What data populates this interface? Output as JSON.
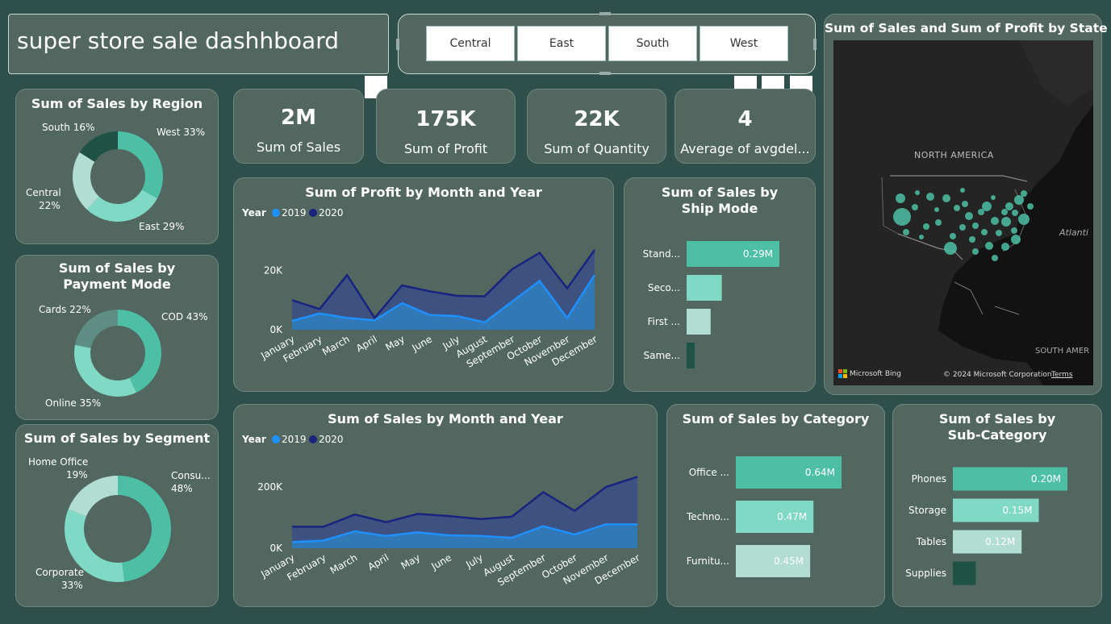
{
  "title": "super store sale dashhboard",
  "slicer": {
    "options": [
      "Central",
      "East",
      "South",
      "West"
    ]
  },
  "kpis": [
    {
      "value": "2M",
      "label": "Sum of Sales"
    },
    {
      "value": "175K",
      "label": "Sum of Profit"
    },
    {
      "value": "22K",
      "label": "Sum of Quantity"
    },
    {
      "value": "4",
      "label": "Average of avgdel..."
    }
  ],
  "map": {
    "title": "Sum of Sales and Sum of Profit by State",
    "label_na": "NORTH AMERICA",
    "label_sa": "SOUTH AMER",
    "label_atl": "Atlanti",
    "brand": "Microsoft Bing",
    "copyright": "© 2024 Microsoft Corporation",
    "terms": "Terms"
  },
  "colors": {
    "bg": "#2f4f4a",
    "card": "#52675f",
    "teal1": "#4cbfa5",
    "teal2": "#7fd9c4",
    "teal3": "#b2ddd3",
    "teal4": "#1e5245",
    "y2019": "#1e90ff",
    "y2020": "#1a237e"
  },
  "chart_data": [
    {
      "id": "region",
      "type": "pie",
      "title": "Sum of Sales by Region",
      "slices": [
        {
          "label": "West",
          "pct_label": "33%",
          "value": 33,
          "color": "#4cbfa5"
        },
        {
          "label": "East",
          "pct_label": "29%",
          "value": 29,
          "color": "#7fd9c4"
        },
        {
          "label": "Central",
          "pct_label": "22%",
          "value": 22,
          "color": "#b2ddd3"
        },
        {
          "label": "South",
          "pct_label": "16%",
          "value": 16,
          "color": "#1e5245"
        }
      ]
    },
    {
      "id": "payment",
      "type": "pie",
      "title": "Sum of Sales by Payment Mode",
      "slices": [
        {
          "label": "COD",
          "pct_label": "43%",
          "value": 43,
          "color": "#4cbfa5"
        },
        {
          "label": "Online",
          "pct_label": "35%",
          "value": 35,
          "color": "#7fd9c4"
        },
        {
          "label": "Cards",
          "pct_label": "22%",
          "value": 22,
          "color": "#5f8f84"
        }
      ]
    },
    {
      "id": "segment",
      "type": "pie",
      "title": "Sum of Sales by Segment",
      "slices": [
        {
          "label": "Consu...",
          "pct_label": "48%",
          "value": 48,
          "color": "#4cbfa5"
        },
        {
          "label": "Corporate",
          "pct_label": "33%",
          "value": 33,
          "color": "#7fd9c4"
        },
        {
          "label": "Home Office",
          "pct_label": "19%",
          "value": 19,
          "color": "#b2ddd3"
        }
      ]
    },
    {
      "id": "profit",
      "type": "area",
      "title": "Sum of Profit by Month and Year",
      "legend_title": "Year",
      "categories": [
        "January",
        "February",
        "March",
        "April",
        "May",
        "June",
        "July",
        "August",
        "September",
        "October",
        "November",
        "December"
      ],
      "ylim": [
        0,
        30000
      ],
      "yticks": [
        {
          "v": 0,
          "label": "0K"
        },
        {
          "v": 20000,
          "label": "20K"
        }
      ],
      "series": [
        {
          "name": "2019",
          "color": "#1e90ff",
          "values": [
            3000,
            5500,
            4000,
            3200,
            9000,
            5000,
            4600,
            2500,
            9500,
            16500,
            4000,
            18500
          ]
        },
        {
          "name": "2020",
          "color": "#1a237e",
          "values": [
            10000,
            7000,
            18500,
            4000,
            15000,
            13000,
            11500,
            11300,
            20500,
            26000,
            14000,
            27000
          ]
        }
      ]
    },
    {
      "id": "sales_month",
      "type": "area",
      "title": "Sum of Sales by Month and Year",
      "legend_title": "Year",
      "categories": [
        "January",
        "February",
        "March",
        "April",
        "May",
        "June",
        "July",
        "August",
        "September",
        "October",
        "November",
        "December"
      ],
      "ylim": [
        0,
        300000
      ],
      "yticks": [
        {
          "v": 0,
          "label": "0K"
        },
        {
          "v": 200000,
          "label": "200K"
        }
      ],
      "series": [
        {
          "name": "2019",
          "color": "#1e90ff",
          "values": [
            20000,
            25000,
            55000,
            40000,
            52000,
            42000,
            40000,
            34000,
            72000,
            45000,
            78000,
            78000
          ]
        },
        {
          "name": "2020",
          "color": "#1a237e",
          "values": [
            70000,
            70000,
            110000,
            85000,
            112000,
            105000,
            95000,
            103000,
            183000,
            122000,
            200000,
            233000
          ]
        }
      ]
    },
    {
      "id": "ship",
      "type": "bar",
      "title": "Sum of Sales by Ship Mode",
      "categories": [
        "Stand...",
        "Seco...",
        "First ...",
        "Same..."
      ],
      "values": [
        0.29,
        0.11,
        0.075,
        0.025
      ],
      "labels": [
        "0.29M",
        "",
        "",
        ""
      ],
      "colors": [
        "#4cbfa5",
        "#7fd9c4",
        "#b2ddd3",
        "#1e5245"
      ],
      "xlim": [
        0,
        0.29
      ]
    },
    {
      "id": "category",
      "type": "bar",
      "title": "Sum of Sales by Category",
      "categories": [
        "Office ...",
        "Techno...",
        "Furnitu..."
      ],
      "values": [
        0.64,
        0.47,
        0.45
      ],
      "labels": [
        "0.64M",
        "0.47M",
        "0.45M"
      ],
      "colors": [
        "#4cbfa5",
        "#7fd9c4",
        "#b2ddd3"
      ],
      "xlim": [
        0,
        0.64
      ]
    },
    {
      "id": "subcat",
      "type": "bar",
      "title": "Sum of Sales by Sub-Category",
      "categories": [
        "Phones",
        "Storage",
        "Tables",
        "Supplies"
      ],
      "values": [
        0.2,
        0.15,
        0.12,
        0.04
      ],
      "labels": [
        "0.20M",
        "0.15M",
        "0.12M",
        ""
      ],
      "colors": [
        "#4cbfa5",
        "#7fd9c4",
        "#b2ddd3",
        "#1e5245"
      ],
      "xlim": [
        0,
        0.2
      ]
    }
  ]
}
